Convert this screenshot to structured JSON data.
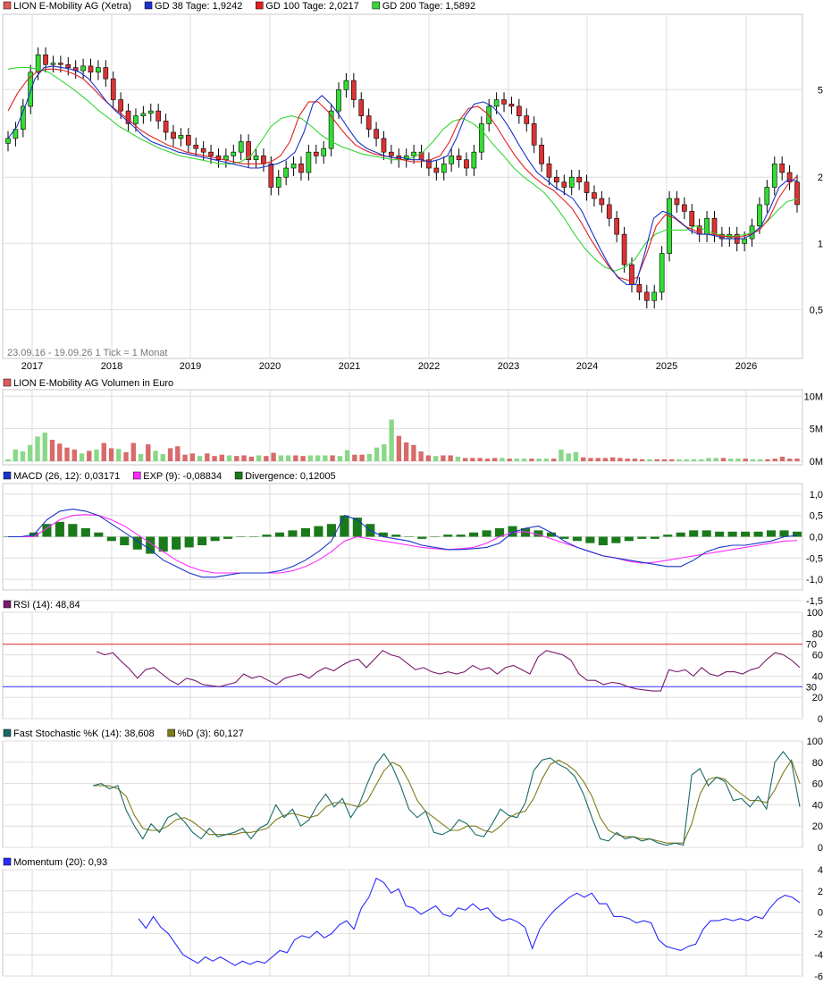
{
  "chart_data": {
    "type": "line",
    "years": [
      "2017",
      "2018",
      "2019",
      "2020",
      "2021",
      "2022",
      "2023",
      "2024",
      "2025",
      "2026"
    ],
    "date_range_note": "23.09.16 - 19.09.26   1 Tick = 1 Monat",
    "price_panel": {
      "legend": [
        {
          "label": "LION E-Mobility AG (Xetra)",
          "color": "#e05a5a"
        },
        {
          "label": "GD 38 Tage: 1,9242",
          "color": "#1a33c8"
        },
        {
          "label": "GD 100 Tage: 2,0217",
          "color": "#e02020"
        },
        {
          "label": "GD 200 Tage: 1,5892",
          "color": "#35d535"
        }
      ],
      "y_scale": "log",
      "y_ticks": [
        {
          "v": 5,
          "t": "5"
        },
        {
          "v": 2,
          "t": "2"
        },
        {
          "v": 1,
          "t": "1"
        },
        {
          "v": 0.5,
          "t": "0,5"
        }
      ],
      "close": [
        3.0,
        3.3,
        4.2,
        6.0,
        7.2,
        6.5,
        6.6,
        6.5,
        6.3,
        6.1,
        6.4,
        6.0,
        6.3,
        5.6,
        4.5,
        4.0,
        3.5,
        3.8,
        3.9,
        4.0,
        3.6,
        3.2,
        3.0,
        3.1,
        2.8,
        2.7,
        2.6,
        2.5,
        2.4,
        2.5,
        2.6,
        2.9,
        2.4,
        2.5,
        2.3,
        1.8,
        2.0,
        2.2,
        2.3,
        2.1,
        2.6,
        2.5,
        2.7,
        4.0,
        5.0,
        5.5,
        4.5,
        3.8,
        3.3,
        3.0,
        2.6,
        2.5,
        2.4,
        2.5,
        2.6,
        2.4,
        2.2,
        2.1,
        2.3,
        2.5,
        2.4,
        2.2,
        2.6,
        3.5,
        4.2,
        4.5,
        4.3,
        4.2,
        3.8,
        3.5,
        2.8,
        2.3,
        2.0,
        1.9,
        1.8,
        2.0,
        1.9,
        1.7,
        1.6,
        1.5,
        1.3,
        1.1,
        0.8,
        0.65,
        0.6,
        0.55,
        0.6,
        0.9,
        1.6,
        1.5,
        1.4,
        1.2,
        1.1,
        1.3,
        1.1,
        1.05,
        1.1,
        1.0,
        1.05,
        1.2,
        1.5,
        1.8,
        2.3,
        2.1,
        1.9,
        1.5
      ],
      "gd38": [
        3.0,
        3.4,
        4.3,
        5.6,
        6.3,
        6.4,
        6.3,
        6.2,
        6.0,
        5.6,
        5.0,
        4.4,
        4.0,
        3.7,
        3.4,
        3.1,
        2.9,
        2.8,
        2.7,
        2.6,
        2.55,
        2.5,
        2.45,
        2.4,
        2.35,
        2.3,
        2.25,
        2.2,
        2.2,
        2.25,
        2.3,
        2.4,
        2.6,
        3.2,
        4.3,
        4.7,
        4.3,
        3.8,
        3.3,
        2.9,
        2.7,
        2.6,
        2.5,
        2.45,
        2.45,
        2.4,
        2.4,
        2.35,
        2.4,
        2.5,
        3.0,
        3.8,
        4.3,
        4.4,
        4.2,
        3.8,
        3.3,
        2.8,
        2.4,
        2.1,
        1.95,
        1.8,
        1.7,
        1.6,
        1.4,
        1.15,
        0.95,
        0.8,
        0.7,
        0.65,
        0.65,
        0.9,
        1.3,
        1.4,
        1.35,
        1.25,
        1.15,
        1.1,
        1.1,
        1.08,
        1.05,
        1.05,
        1.05,
        1.1,
        1.2,
        1.45,
        1.8,
        1.95,
        1.92
      ],
      "gd100": [
        4.0,
        4.8,
        5.5,
        6.0,
        6.2,
        6.2,
        6.1,
        5.9,
        5.6,
        5.1,
        4.6,
        4.2,
        3.9,
        3.6,
        3.3,
        3.1,
        2.95,
        2.8,
        2.7,
        2.6,
        2.55,
        2.5,
        2.45,
        2.4,
        2.35,
        2.3,
        2.3,
        2.3,
        2.35,
        2.5,
        2.9,
        3.8,
        4.4,
        4.4,
        4.0,
        3.5,
        3.1,
        2.8,
        2.65,
        2.55,
        2.5,
        2.45,
        2.4,
        2.35,
        2.35,
        2.4,
        2.5,
        2.9,
        3.6,
        4.1,
        4.2,
        3.9,
        3.4,
        2.9,
        2.5,
        2.2,
        2.0,
        1.85,
        1.75,
        1.6,
        1.45,
        1.25,
        1.05,
        0.9,
        0.78,
        0.7,
        0.68,
        0.7,
        0.9,
        1.2,
        1.35,
        1.3,
        1.2,
        1.15,
        1.1,
        1.1,
        1.08,
        1.07,
        1.07,
        1.1,
        1.15,
        1.3,
        1.6,
        1.85,
        2.02
      ],
      "gd200": [
        6.2,
        6.3,
        6.3,
        6.2,
        6.0,
        5.6,
        5.2,
        4.8,
        4.4,
        4.0,
        3.7,
        3.4,
        3.2,
        3.0,
        2.85,
        2.7,
        2.6,
        2.5,
        2.45,
        2.4,
        2.35,
        2.3,
        2.3,
        2.35,
        2.5,
        2.9,
        3.4,
        3.7,
        3.8,
        3.7,
        3.4,
        3.1,
        2.9,
        2.75,
        2.65,
        2.55,
        2.5,
        2.45,
        2.4,
        2.4,
        2.45,
        2.6,
        2.9,
        3.3,
        3.6,
        3.7,
        3.5,
        3.2,
        2.8,
        2.5,
        2.2,
        2.0,
        1.85,
        1.7,
        1.5,
        1.3,
        1.1,
        0.95,
        0.85,
        0.78,
        0.75,
        0.78,
        0.85,
        1.0,
        1.1,
        1.15,
        1.15,
        1.15,
        1.2,
        1.15,
        1.1,
        1.08,
        1.08,
        1.1,
        1.15,
        1.25,
        1.4,
        1.55,
        1.59
      ]
    },
    "volume_panel": {
      "legend": [
        {
          "label": "LION E-Mobility AG Volumen in Euro",
          "color": "#e05a5a"
        }
      ],
      "y_ticks": [
        {
          "v": 10,
          "t": "10M"
        },
        {
          "v": 5,
          "t": "5M"
        },
        {
          "v": 0,
          "t": "0M"
        }
      ],
      "values_m": [
        0.3,
        1.8,
        1.5,
        2.5,
        3.8,
        4.4,
        3.3,
        2.7,
        2.1,
        1.8,
        1.2,
        1.6,
        1.8,
        2.8,
        2.0,
        1.9,
        1.4,
        2.8,
        1.1,
        2.6,
        1.6,
        1.1,
        2.0,
        2.3,
        1.0,
        1.2,
        0.8,
        1.2,
        0.8,
        1.0,
        0.9,
        0.8,
        0.9,
        0.7,
        0.9,
        0.8,
        1.3,
        0.9,
        0.9,
        0.9,
        0.8,
        0.9,
        0.9,
        0.9,
        0.9,
        0.8,
        1.7,
        1.0,
        1.0,
        1.1,
        2.1,
        2.6,
        6.4,
        3.9,
        2.9,
        2.5,
        1.5,
        0.9,
        0.8,
        0.9,
        0.9,
        0.7,
        0.5,
        0.5,
        0.5,
        0.4,
        0.5,
        0.5,
        0.4,
        0.4,
        0.4,
        0.4,
        0.4,
        0.4,
        0.4,
        1.8,
        1.2,
        1.4,
        0.6,
        0.5,
        0.5,
        0.5,
        0.6,
        0.5,
        0.4,
        0.4,
        0.3,
        0.3,
        0.3,
        0.3,
        0.3,
        0.3,
        0.3,
        0.3,
        0.3,
        0.5,
        0.5,
        0.5,
        0.4,
        0.4,
        0.4,
        0.3,
        0.3,
        0.3,
        0.4,
        0.7,
        0.4,
        0.4
      ],
      "up": [
        1,
        1,
        1,
        1,
        1,
        1,
        0,
        0,
        0,
        0,
        1,
        0,
        1,
        0,
        0,
        1,
        0,
        0,
        1,
        0,
        1,
        1,
        0,
        0,
        0,
        0,
        1,
        0,
        0,
        0,
        1,
        0,
        0,
        0,
        1,
        0,
        0,
        1,
        1,
        0,
        0,
        1,
        1,
        1,
        0,
        1,
        1,
        0,
        0,
        1,
        1,
        1,
        1,
        0,
        0,
        0,
        0,
        0,
        1,
        0,
        0,
        1,
        0,
        0,
        0,
        0,
        0,
        1,
        0,
        1,
        1,
        0,
        1,
        1,
        0,
        1,
        1,
        1,
        0,
        0,
        0,
        0,
        0,
        0,
        0,
        0,
        0,
        1,
        0,
        0,
        0,
        1,
        1,
        1,
        1,
        1,
        1,
        0,
        1,
        1,
        0,
        1,
        1,
        0,
        0,
        0
      ]
    },
    "macd_panel": {
      "legend": [
        {
          "label": "MACD (26, 12): 0,03171",
          "color": "#1a33c8"
        },
        {
          "label": "EXP (9): -0,08834",
          "color": "#ff2aff"
        },
        {
          "label": "Divergence: 0,12005",
          "color": "#1a7a1a"
        }
      ],
      "y_ticks": [
        {
          "v": 1.0,
          "t": "1,0"
        },
        {
          "v": 0.5,
          "t": "0,5"
        },
        {
          "v": 0.0,
          "t": "0,0"
        },
        {
          "v": -0.5,
          "t": "-0,5"
        },
        {
          "v": -1.0,
          "t": "-1,0"
        },
        {
          "v": -1.5,
          "t": "-1,5"
        }
      ],
      "macd": [
        0,
        0,
        0.05,
        0.4,
        0.6,
        0.65,
        0.6,
        0.5,
        0.3,
        0.1,
        -0.1,
        -0.3,
        -0.55,
        -0.7,
        -0.85,
        -0.95,
        -0.95,
        -0.9,
        -0.85,
        -0.85,
        -0.85,
        -0.8,
        -0.7,
        -0.55,
        -0.35,
        -0.1,
        0.5,
        0.4,
        0.15,
        0.0,
        -0.05,
        -0.1,
        -0.2,
        -0.25,
        -0.3,
        -0.3,
        -0.28,
        -0.25,
        -0.15,
        0.1,
        0.2,
        0.25,
        0.1,
        -0.1,
        -0.25,
        -0.35,
        -0.45,
        -0.5,
        -0.55,
        -0.6,
        -0.65,
        -0.7,
        -0.7,
        -0.55,
        -0.35,
        -0.25,
        -0.2,
        -0.2,
        -0.15,
        -0.1,
        0.0,
        0.03
      ],
      "exp": [
        0,
        0,
        0,
        0.2,
        0.4,
        0.5,
        0.52,
        0.5,
        0.4,
        0.25,
        0.05,
        -0.15,
        -0.35,
        -0.55,
        -0.7,
        -0.8,
        -0.85,
        -0.85,
        -0.85,
        -0.85,
        -0.85,
        -0.85,
        -0.8,
        -0.7,
        -0.55,
        -0.35,
        -0.1,
        0.0,
        -0.05,
        -0.1,
        -0.15,
        -0.2,
        -0.25,
        -0.28,
        -0.3,
        -0.28,
        -0.25,
        -0.15,
        0.0,
        0.1,
        0.12,
        0.05,
        -0.05,
        -0.15,
        -0.25,
        -0.35,
        -0.45,
        -0.5,
        -0.58,
        -0.62,
        -0.6,
        -0.55,
        -0.5,
        -0.45,
        -0.4,
        -0.35,
        -0.3,
        -0.25,
        -0.2,
        -0.15,
        -0.1,
        -0.09
      ],
      "div": [
        0,
        0,
        0.1,
        0.3,
        0.35,
        0.3,
        0.2,
        0.1,
        -0.1,
        -0.2,
        -0.3,
        -0.4,
        -0.35,
        -0.3,
        -0.25,
        -0.2,
        -0.1,
        -0.05,
        0.0,
        0.0,
        0.05,
        0.1,
        0.15,
        0.2,
        0.25,
        0.3,
        0.5,
        0.45,
        0.3,
        0.1,
        0.05,
        0.0,
        -0.05,
        0.0,
        0.05,
        0.05,
        0.1,
        0.15,
        0.2,
        0.25,
        0.2,
        0.15,
        0.1,
        -0.05,
        -0.1,
        -0.15,
        -0.2,
        -0.15,
        -0.1,
        -0.05,
        -0.05,
        0.05,
        0.1,
        0.15,
        0.15,
        0.12,
        0.12,
        0.12,
        0.12,
        0.15,
        0.15,
        0.12
      ]
    },
    "rsi_panel": {
      "legend": [
        {
          "label": "RSI (14): 48,84",
          "color": "#7a1a6a"
        }
      ],
      "y_ticks": [
        {
          "v": 100,
          "t": "100"
        },
        {
          "v": 80,
          "t": "80"
        },
        {
          "v": 60,
          "t": "60"
        },
        {
          "v": 40,
          "t": "40"
        },
        {
          "v": 20,
          "t": "20"
        },
        {
          "v": 0,
          "t": "0"
        }
      ],
      "levels": [
        {
          "v": 70,
          "t": "70",
          "color": "#e02020"
        },
        {
          "v": 30,
          "t": "30",
          "color": "#2a2aff"
        }
      ],
      "values": [
        63,
        60,
        62,
        54,
        47,
        38,
        46,
        48,
        42,
        36,
        32,
        38,
        36,
        32,
        31,
        30,
        32,
        34,
        42,
        38,
        40,
        36,
        32,
        38,
        40,
        42,
        38,
        44,
        48,
        45,
        50,
        54,
        56,
        48,
        56,
        64,
        60,
        58,
        52,
        46,
        48,
        44,
        42,
        44,
        42,
        44,
        50,
        46,
        48,
        42,
        48,
        50,
        46,
        42,
        58,
        64,
        62,
        60,
        55,
        42,
        36,
        36,
        32,
        34,
        33,
        30,
        28,
        27,
        26,
        26,
        46,
        44,
        46,
        40,
        48,
        42,
        40,
        44,
        44,
        42,
        46,
        48,
        56,
        62,
        60,
        55,
        48
      ]
    },
    "stoch_panel": {
      "legend": [
        {
          "label": "Fast Stochastic %K (14): 38,608",
          "color": "#1a6a6a"
        },
        {
          "label": "%D (3): 60,127",
          "color": "#807a1a"
        }
      ],
      "y_ticks": [
        {
          "v": 100,
          "t": "100"
        },
        {
          "v": 80,
          "t": "80"
        },
        {
          "v": 60,
          "t": "60"
        },
        {
          "v": 40,
          "t": "40"
        },
        {
          "v": 20,
          "t": "20"
        },
        {
          "v": 0,
          "t": "0"
        }
      ],
      "k": [
        58,
        60,
        55,
        58,
        35,
        20,
        8,
        22,
        14,
        28,
        32,
        24,
        14,
        8,
        18,
        10,
        12,
        14,
        18,
        8,
        18,
        22,
        40,
        28,
        36,
        20,
        26,
        40,
        50,
        38,
        46,
        28,
        40,
        60,
        78,
        88,
        76,
        58,
        36,
        28,
        34,
        14,
        12,
        16,
        26,
        22,
        12,
        10,
        22,
        36,
        30,
        28,
        42,
        72,
        82,
        84,
        78,
        74,
        66,
        50,
        28,
        8,
        6,
        14,
        8,
        10,
        6,
        8,
        4,
        2,
        4,
        2,
        68,
        74,
        58,
        66,
        62,
        44,
        46,
        38,
        48,
        36,
        80,
        90,
        80,
        38
      ],
      "d": [
        58,
        58,
        58,
        55,
        48,
        30,
        18,
        16,
        16,
        20,
        26,
        28,
        24,
        18,
        12,
        12,
        12,
        12,
        14,
        14,
        16,
        18,
        26,
        30,
        32,
        30,
        28,
        30,
        38,
        42,
        42,
        40,
        38,
        44,
        58,
        72,
        80,
        76,
        62,
        44,
        34,
        28,
        22,
        16,
        16,
        20,
        20,
        16,
        14,
        20,
        28,
        32,
        34,
        46,
        64,
        78,
        82,
        78,
        72,
        62,
        48,
        28,
        16,
        12,
        10,
        10,
        8,
        8,
        6,
        4,
        4,
        4,
        22,
        50,
        64,
        66,
        64,
        56,
        50,
        44,
        44,
        42,
        54,
        70,
        82,
        60
      ]
    },
    "momentum_panel": {
      "legend": [
        {
          "label": "Momentum (20): 0,93",
          "color": "#2a2aff"
        }
      ],
      "y_ticks": [
        {
          "v": 4,
          "t": "4"
        },
        {
          "v": 2,
          "t": "2"
        },
        {
          "v": 0,
          "t": "0"
        },
        {
          "v": -2,
          "t": "-2"
        },
        {
          "v": -4,
          "t": "-4"
        },
        {
          "v": -6,
          "t": "-6"
        }
      ],
      "values": [
        -0.6,
        -1.5,
        -0.4,
        -1.4,
        -2.0,
        -3.0,
        -4.0,
        -4.4,
        -4.8,
        -4.2,
        -4.6,
        -4.2,
        -4.6,
        -5.0,
        -4.6,
        -4.9,
        -4.6,
        -4.8,
        -4.2,
        -3.6,
        -3.8,
        -2.6,
        -2.2,
        -2.4,
        -1.8,
        -2.4,
        -2.0,
        -1.2,
        -0.8,
        -1.6,
        0.4,
        1.4,
        3.2,
        2.8,
        1.8,
        2.2,
        0.6,
        0.4,
        -0.2,
        0.2,
        0.6,
        -0.2,
        -0.4,
        0.4,
        0.2,
        0.8,
        0.2,
        0.4,
        -0.4,
        -0.8,
        -0.6,
        -0.9,
        -1.4,
        -3.4,
        -1.6,
        -0.6,
        0.2,
        0.8,
        1.4,
        1.8,
        1.4,
        1.8,
        0.8,
        0.8,
        -0.4,
        -0.4,
        -0.6,
        -1.0,
        -0.8,
        -1.0,
        -2.6,
        -3.2,
        -3.4,
        -3.6,
        -3.2,
        -3.0,
        -1.6,
        -0.8,
        -0.8,
        -0.6,
        -0.8,
        -0.6,
        -0.8,
        -0.4,
        -0.6,
        0.4,
        1.2,
        1.6,
        1.4,
        0.9
      ]
    }
  }
}
